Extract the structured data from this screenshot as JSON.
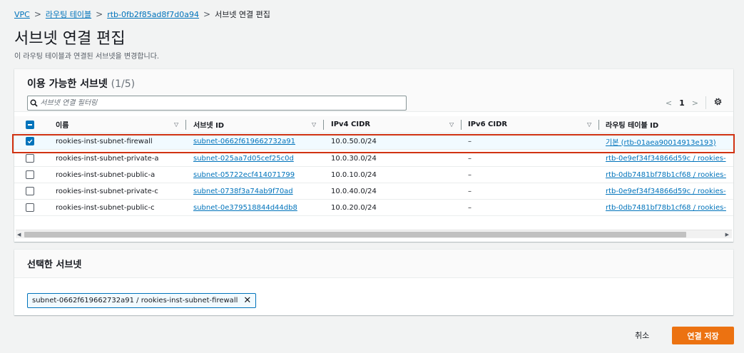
{
  "breadcrumb": {
    "items": [
      "VPC",
      "라우팅 테이블",
      "rtb-0fb2f85ad8f7d0a94"
    ],
    "current": "서브넷 연결 편집",
    "separator": ">"
  },
  "page": {
    "title": "서브넷 연결 편집",
    "description": "이 라우팅 테이블과 연결된 서브넷을 변경합니다."
  },
  "available": {
    "title": "이용 가능한 서브넷",
    "count": "(1/5)",
    "filter_placeholder": "서브넷 연결 필터링",
    "pagination": {
      "prev": "<",
      "page": "1",
      "next": ">"
    },
    "columns": [
      "이름",
      "서브넷 ID",
      "IPv4 CIDR",
      "IPv6 CIDR",
      "라우팅 테이블 ID"
    ],
    "rows": [
      {
        "checked": true,
        "name": "rookies-inst-subnet-firewall",
        "subnet_id": "subnet-0662f619662732a91",
        "ipv4": "10.0.50.0/24",
        "ipv6": "–",
        "route_table": "기본 (rtb-01aea90014913e193)"
      },
      {
        "checked": false,
        "name": "rookies-inst-subnet-private-a",
        "subnet_id": "subnet-025aa7d05cef25c0d",
        "ipv4": "10.0.30.0/24",
        "ipv6": "–",
        "route_table": "rtb-0e9ef34f34866d59c / rookies-"
      },
      {
        "checked": false,
        "name": "rookies-inst-subnet-public-a",
        "subnet_id": "subnet-05722ecf414071799",
        "ipv4": "10.0.10.0/24",
        "ipv6": "–",
        "route_table": "rtb-0db7481bf78b1cf68 / rookies-"
      },
      {
        "checked": false,
        "name": "rookies-inst-subnet-private-c",
        "subnet_id": "subnet-0738f3a74ab9f70ad",
        "ipv4": "10.0.40.0/24",
        "ipv6": "–",
        "route_table": "rtb-0e9ef34f34866d59c / rookies-"
      },
      {
        "checked": false,
        "name": "rookies-inst-subnet-public-c",
        "subnet_id": "subnet-0e379518844d44db8",
        "ipv4": "10.0.20.0/24",
        "ipv6": "–",
        "route_table": "rtb-0db7481bf78b1cf68 / rookies-"
      }
    ]
  },
  "selected": {
    "title": "선택한 서브넷",
    "tokens": [
      "subnet-0662f619662732a91 / rookies-inst-subnet-firewall"
    ]
  },
  "actions": {
    "cancel": "취소",
    "save": "연결 저장"
  },
  "colors": {
    "link": "#0073bb",
    "primary_button": "#ec7211",
    "highlight_border": "#d13212",
    "checkbox": "#0073bb"
  }
}
